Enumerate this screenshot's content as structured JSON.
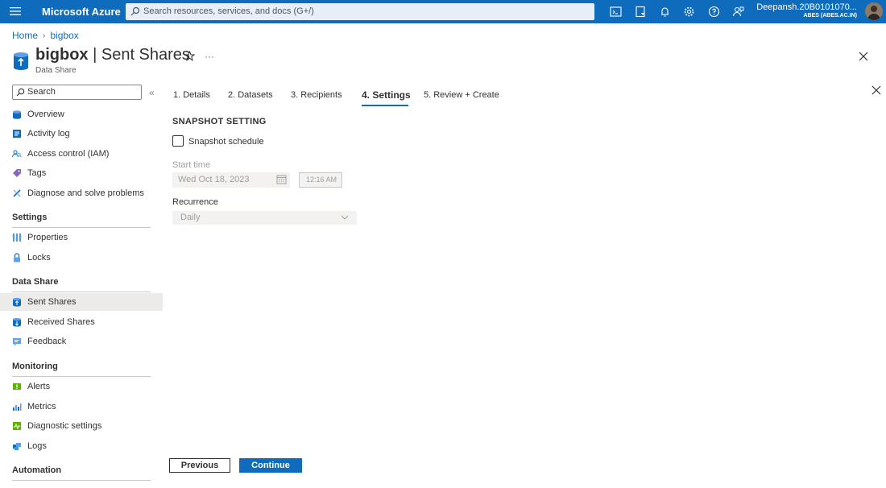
{
  "topbar": {
    "brand": "Microsoft Azure",
    "search_placeholder": "Search resources, services, and docs (G+/)",
    "icons": [
      "cloud-shell-icon",
      "directory-filter-icon",
      "notifications-icon",
      "settings-icon",
      "help-icon",
      "feedback-icon"
    ],
    "user_name": "Deepansh.20B0101070...",
    "user_directory": "ABES (ABES.AC.IN)",
    "accent": "#0f6cbd"
  },
  "breadcrumb": {
    "home": "Home",
    "resource": "bigbox"
  },
  "header": {
    "resource_name": "bigbox",
    "separator": " | ",
    "page_name": "Sent Shares",
    "resource_type": "Data Share",
    "more": "···"
  },
  "sidebar": {
    "search_placeholder": "Search",
    "collapse": "«",
    "top_items": [
      {
        "label": "Overview",
        "icon": "overview-icon"
      },
      {
        "label": "Activity log",
        "icon": "activity-log-icon"
      },
      {
        "label": "Access control (IAM)",
        "icon": "iam-icon"
      },
      {
        "label": "Tags",
        "icon": "tag-icon"
      },
      {
        "label": "Diagnose and solve problems",
        "icon": "wrench-icon"
      }
    ],
    "sections": [
      {
        "title": "Settings",
        "items": [
          {
            "label": "Properties",
            "icon": "properties-icon"
          },
          {
            "label": "Locks",
            "icon": "lock-icon"
          }
        ]
      },
      {
        "title": "Data Share",
        "items": [
          {
            "label": "Sent Shares",
            "icon": "sent-shares-icon",
            "active": true
          },
          {
            "label": "Received Shares",
            "icon": "received-shares-icon"
          },
          {
            "label": "Feedback",
            "icon": "feedback-icon"
          }
        ]
      },
      {
        "title": "Monitoring",
        "items": [
          {
            "label": "Alerts",
            "icon": "alert-icon"
          },
          {
            "label": "Metrics",
            "icon": "metrics-icon"
          },
          {
            "label": "Diagnostic settings",
            "icon": "diagnostic-icon"
          },
          {
            "label": "Logs",
            "icon": "logs-icon"
          }
        ]
      },
      {
        "title": "Automation",
        "items": []
      }
    ]
  },
  "wizard": {
    "tabs": [
      {
        "label": "1. Details"
      },
      {
        "label": "2. Datasets"
      },
      {
        "label": "3. Recipients"
      },
      {
        "label": "4. Settings",
        "active": true
      },
      {
        "label": "5. Review + Create"
      }
    ],
    "section_title": "SNAPSHOT SETTING",
    "checkbox_label": "Snapshot schedule",
    "checkbox_checked": false,
    "start_time_label": "Start time",
    "start_date_value": "Wed Oct 18, 2023",
    "start_time_value": "12:16 AM",
    "recurrence_label": "Recurrence",
    "recurrence_value": "Daily",
    "previous_label": "Previous",
    "continue_label": "Continue"
  }
}
